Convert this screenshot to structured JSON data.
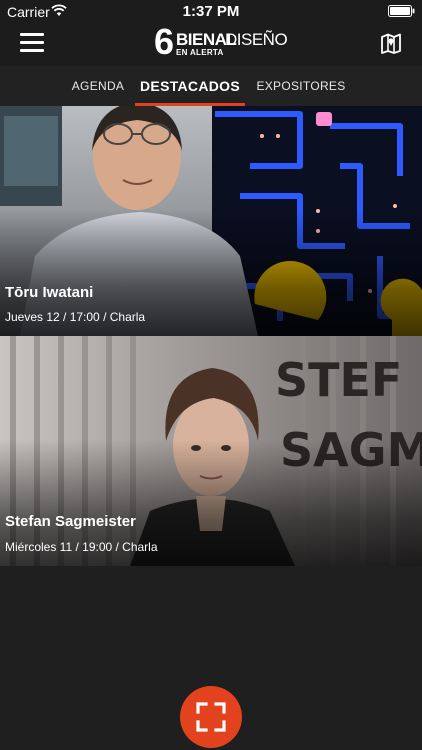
{
  "status_bar": {
    "carrier": "Carrier",
    "time": "1:37 PM",
    "wifi_icon": "wifi-icon",
    "battery_icon": "battery-full-icon"
  },
  "nav": {
    "menu_icon": "hamburger-menu-icon",
    "logo": {
      "number": "6",
      "word1": "BIENAL",
      "word2": "DISEÑO",
      "tagline": "EN ALERTA"
    },
    "map_icon": "map-icon"
  },
  "tabs": [
    {
      "label": "AGENDA",
      "active": false
    },
    {
      "label": "DESTACADOS",
      "active": true
    },
    {
      "label": "EXPOSITORES",
      "active": false
    }
  ],
  "events": [
    {
      "name": "Tōru Iwatani",
      "details": "Jueves 12 / 17:00 / Charla"
    },
    {
      "name": "Stefan Sagmeister",
      "details": "Miércoles 11 / 19:00 / Charla"
    }
  ],
  "scan_button": {
    "icon": "scan-frame-icon"
  },
  "colors": {
    "accent": "#e2431e",
    "background": "#1f1f1f",
    "bar": "#1c1c1c"
  }
}
